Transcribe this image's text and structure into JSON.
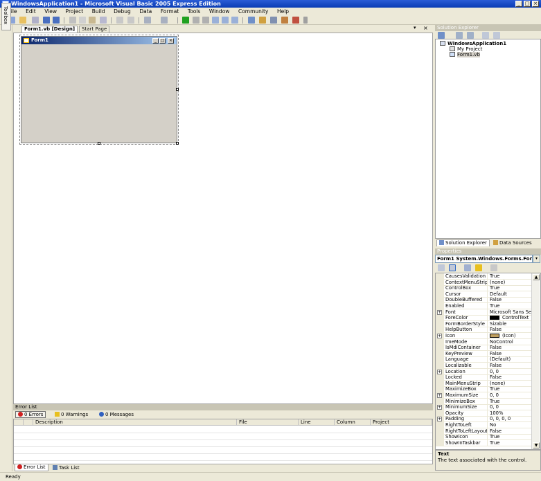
{
  "app": {
    "title": "WindowsApplication1 - Microsoft Visual Basic 2005 Express Edition"
  },
  "window_buttons": {
    "minimize": "_",
    "maximize": "□",
    "close": "×"
  },
  "menu": [
    "File",
    "Edit",
    "View",
    "Project",
    "Build",
    "Debug",
    "Data",
    "Format",
    "Tools",
    "Window",
    "Community",
    "Help"
  ],
  "toolbox": {
    "label": "Toolbox"
  },
  "doc_tabs": [
    "Form1.vb [Design]",
    "Start Page"
  ],
  "doc_controls": {
    "dropdown": "▾",
    "close": "×"
  },
  "form": {
    "title": "Form1"
  },
  "error_list": {
    "title": "Error List",
    "filters": [
      "0 Errors",
      "0 Warnings",
      "0 Messages"
    ],
    "columns": [
      "",
      "",
      "Description",
      "File",
      "Line",
      "Column",
      "Project"
    ]
  },
  "bottom_tabs": [
    "Error List",
    "Task List"
  ],
  "status": "Ready",
  "solution_explorer": {
    "title": "Solution Explorer",
    "tree": [
      "WindowsApplication1",
      "My Project",
      "Form1.vb"
    ],
    "tabs": [
      "Solution Explorer",
      "Data Sources"
    ]
  },
  "properties": {
    "title": "Properties",
    "object": "Form1  System.Windows.Forms.Form",
    "rows": [
      {
        "name": "CausesValidation",
        "value": "True"
      },
      {
        "name": "ContextMenuStrip",
        "value": "(none)"
      },
      {
        "name": "ControlBox",
        "value": "True"
      },
      {
        "name": "Cursor",
        "value": "Default"
      },
      {
        "name": "DoubleBuffered",
        "value": "False"
      },
      {
        "name": "Enabled",
        "value": "True"
      },
      {
        "name": "Font",
        "value": "Microsoft Sans Se",
        "expand": "+"
      },
      {
        "name": "ForeColor",
        "value": "ControlText",
        "swatch": "#000000"
      },
      {
        "name": "FormBorderStyle",
        "value": "Sizable"
      },
      {
        "name": "HelpButton",
        "value": "False"
      },
      {
        "name": "Icon",
        "value": "(Icon)",
        "expand": "+",
        "swatch": "#c0a060"
      },
      {
        "name": "ImeMode",
        "value": "NoControl"
      },
      {
        "name": "IsMdiContainer",
        "value": "False"
      },
      {
        "name": "KeyPreview",
        "value": "False"
      },
      {
        "name": "Language",
        "value": "(Default)"
      },
      {
        "name": "Localizable",
        "value": "False"
      },
      {
        "name": "Location",
        "value": "0, 0",
        "expand": "+"
      },
      {
        "name": "Locked",
        "value": "False"
      },
      {
        "name": "MainMenuStrip",
        "value": "(none)"
      },
      {
        "name": "MaximizeBox",
        "value": "True"
      },
      {
        "name": "MaximumSize",
        "value": "0, 0",
        "expand": "+"
      },
      {
        "name": "MinimizeBox",
        "value": "True"
      },
      {
        "name": "MinimumSize",
        "value": "0, 0",
        "expand": "+"
      },
      {
        "name": "Opacity",
        "value": "100%"
      },
      {
        "name": "Padding",
        "value": "0, 0, 0, 0",
        "expand": "+"
      },
      {
        "name": "RightToLeft",
        "value": "No"
      },
      {
        "name": "RightToLeftLayout",
        "value": "False"
      },
      {
        "name": "ShowIcon",
        "value": "True"
      },
      {
        "name": "ShowInTaskbar",
        "value": "True"
      }
    ],
    "desc_title": "Text",
    "desc_text": "The text associated with the control."
  },
  "colors": {
    "titlebar": "#0a3cb4",
    "chrome": "#ece9d8",
    "form_caption": "#0a246a"
  }
}
